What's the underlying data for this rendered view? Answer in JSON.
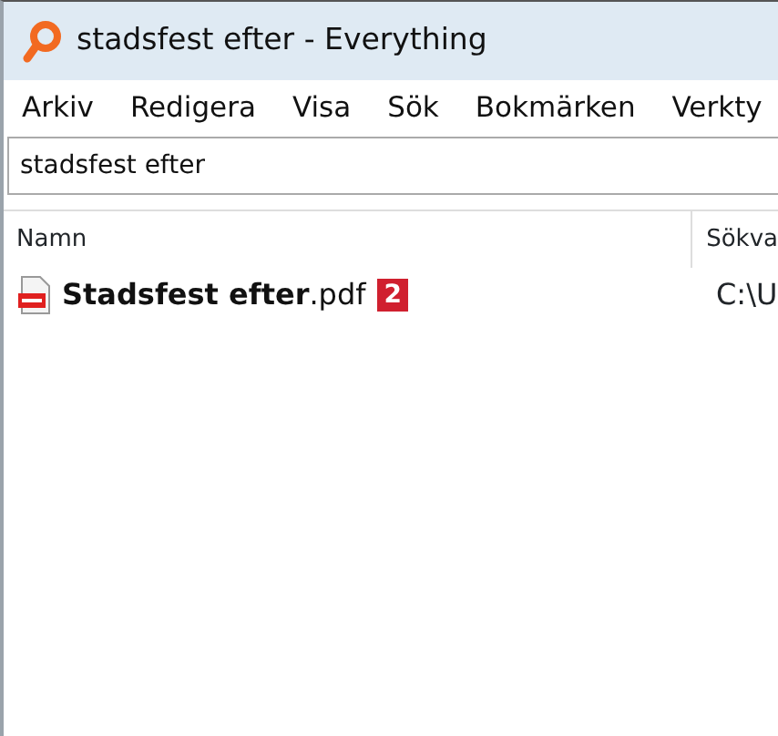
{
  "window": {
    "title": "stadsfest efter - Everything"
  },
  "menu": [
    "Arkiv",
    "Redigera",
    "Visa",
    "Sök",
    "Bokmärken",
    "Verkty"
  ],
  "search": {
    "value": "stadsfest efter"
  },
  "table": {
    "columns": [
      "Namn",
      "Sökva"
    ],
    "rows": [
      {
        "name": "**Stadsfest efter**.pdf",
        "path": "C:\\U"
      }
    ]
  },
  "callout": "2"
}
